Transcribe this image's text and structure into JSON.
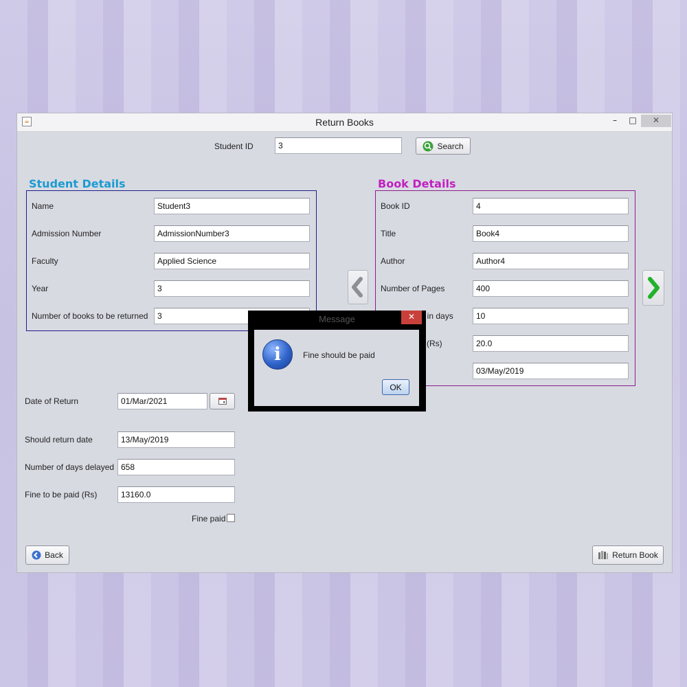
{
  "window": {
    "title": "Return Books",
    "minimize": "–",
    "maximize": "□",
    "close": "✕"
  },
  "search": {
    "label": "Student ID",
    "value": "3",
    "button_label": "Search"
  },
  "student": {
    "heading": "Student Details",
    "heading_color": "#1a9bd1",
    "fields": [
      {
        "label": "Name",
        "value": "Student3"
      },
      {
        "label": "Admission Number",
        "value": "AdmissionNumber3"
      },
      {
        "label": "Faculty",
        "value": "Applied Science"
      },
      {
        "label": "Year",
        "value": "3"
      },
      {
        "label": "Number of books to be returned",
        "value": "3"
      }
    ]
  },
  "book": {
    "heading": "Book Details",
    "heading_color": "#c020c0",
    "fields": [
      {
        "label": "Book ID",
        "value": "4"
      },
      {
        "label": "Title",
        "value": "Book4"
      },
      {
        "label": "Author",
        "value": "Author4"
      },
      {
        "label": "Number of Pages",
        "value": "400"
      },
      {
        "label": "od in days",
        "value": "10"
      },
      {
        "label": "(Rs)",
        "value": "20.0"
      },
      {
        "label": "",
        "value": "03/May/2019"
      }
    ]
  },
  "returns": {
    "date_of_return_label": "Date of Return",
    "date_of_return_value": "01/Mar/2021",
    "should_return_label": "Should return date",
    "should_return_value": "13/May/2019",
    "days_delayed_label": "Number of days delayed",
    "days_delayed_value": "658",
    "fine_label": "Fine to be paid (Rs)",
    "fine_value": "13160.0",
    "fine_paid_label": "Fine paid",
    "fine_paid_checked": false
  },
  "footer": {
    "back_label": "Back",
    "return_label": "Return Book"
  },
  "dialog": {
    "title": "Message",
    "close": "✕",
    "message": "Fine should be paid",
    "ok_label": "OK"
  }
}
